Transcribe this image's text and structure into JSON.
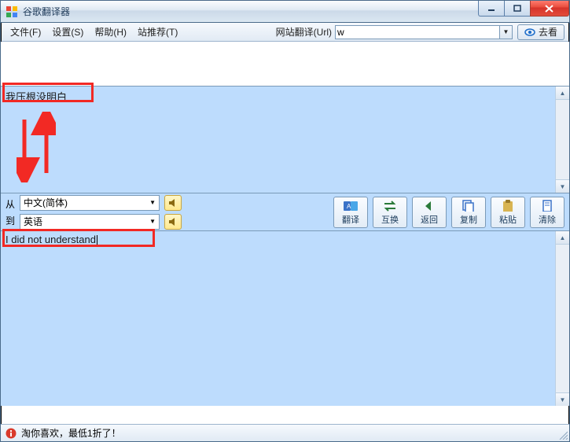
{
  "title": "谷歌翻译器",
  "win": {
    "min": "—",
    "max": "□",
    "close": "×"
  },
  "menu": {
    "file": "文件(F)",
    "settings": "设置(S)",
    "help": "帮助(H)",
    "recommend": "站推荐(T)"
  },
  "url_translate": {
    "label": "网站翻译(Url)",
    "value": "w",
    "go": "去看"
  },
  "source_text": "我压根没明白",
  "lang": {
    "from_label": "从",
    "to_label": "到",
    "from_value": "中文(简体)",
    "to_value": "英语"
  },
  "toolbar": {
    "translate": "翻译",
    "swap": "互换",
    "back": "返回",
    "copy": "复制",
    "paste": "粘贴",
    "clear": "清除"
  },
  "output_text": "I did not understand",
  "status_text": "淘你喜欢，最低1折了！"
}
